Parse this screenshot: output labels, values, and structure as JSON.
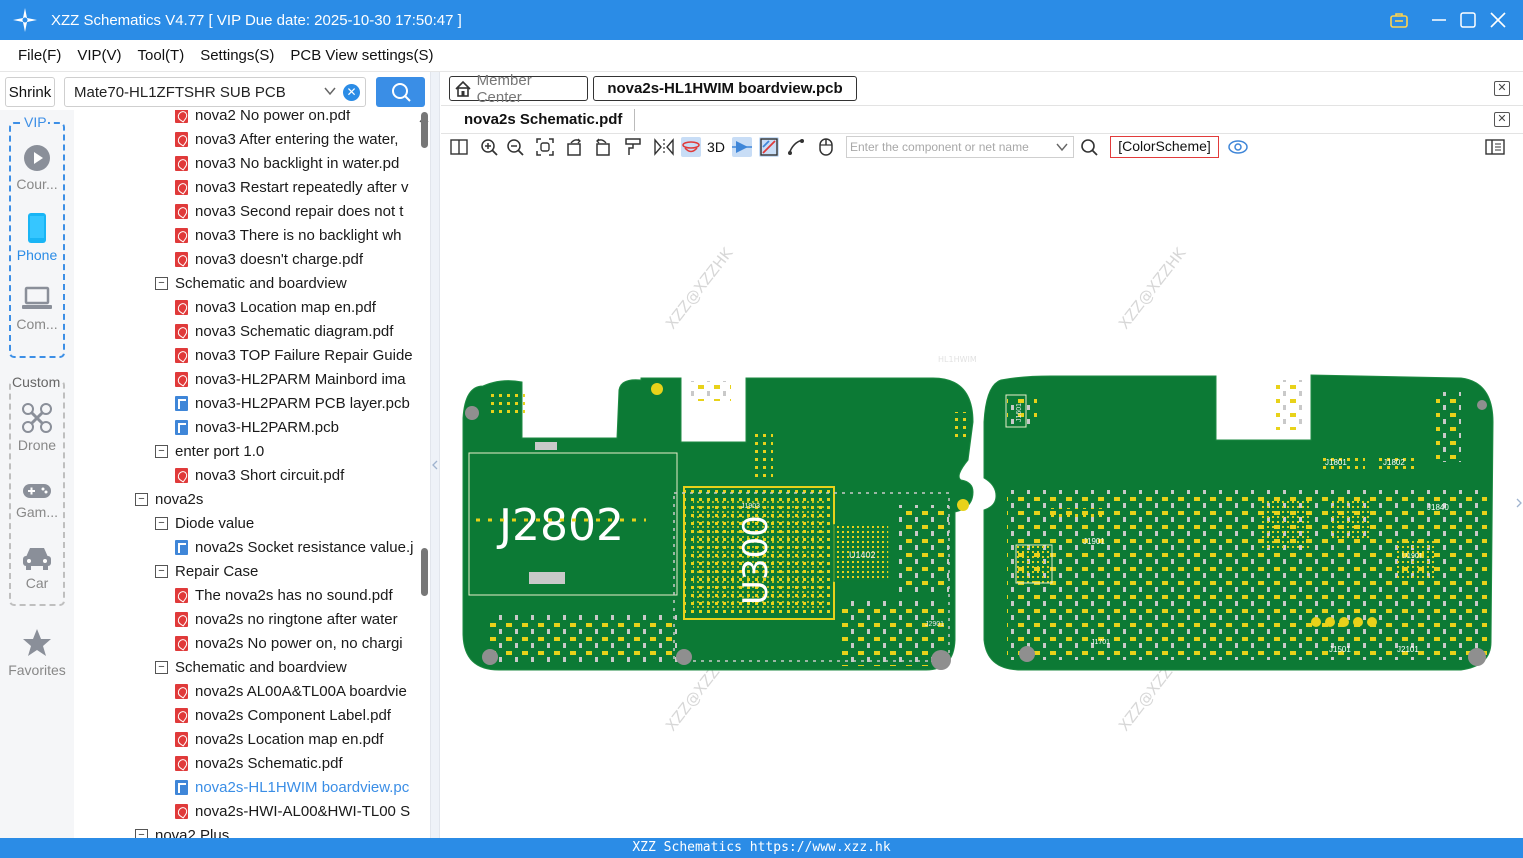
{
  "window": {
    "title": "XZZ Schematics V4.77 [ VIP Due date: 2025-10-30 17:50:47 ]"
  },
  "menu": [
    "File(F)",
    "VIP(V)",
    "Tool(T)",
    "Settings(S)",
    "PCB View settings(S)"
  ],
  "search": {
    "shrink_label": "Shrink",
    "model_value": "Mate70-HL1ZFTSHR SUB PCB"
  },
  "rail": {
    "vip_label": "VIP",
    "custom_label": "Custom",
    "categories": [
      {
        "label": "Cour...",
        "icon": "play-course-icon"
      },
      {
        "label": "Phone",
        "icon": "phone-icon"
      },
      {
        "label": "Com...",
        "icon": "laptop-icon"
      },
      {
        "label": "Drone",
        "icon": "drone-icon"
      },
      {
        "label": "Gam...",
        "icon": "gamepad-icon"
      },
      {
        "label": "Car",
        "icon": "car-icon"
      },
      {
        "label": "Favorites",
        "icon": "star-icon"
      }
    ]
  },
  "tree": [
    {
      "label": "nova2 No power on.pdf",
      "type": "pdf",
      "level": 2
    },
    {
      "label": "nova3 After entering the water,",
      "type": "pdf",
      "level": 2
    },
    {
      "label": "nova3 No backlight in water.pd",
      "type": "pdf",
      "level": 2
    },
    {
      "label": "nova3 Restart repeatedly after v",
      "type": "pdf",
      "level": 2
    },
    {
      "label": "nova3 Second repair does not t",
      "type": "pdf",
      "level": 2
    },
    {
      "label": "nova3 There is no backlight wh",
      "type": "pdf",
      "level": 2
    },
    {
      "label": "nova3 doesn't charge.pdf",
      "type": "pdf",
      "level": 2
    },
    {
      "label": "Schematic and boardview",
      "type": "folder",
      "level": 1
    },
    {
      "label": "nova3 Location map en.pdf",
      "type": "pdf",
      "level": 2
    },
    {
      "label": "nova3 Schematic diagram.pdf",
      "type": "pdf",
      "level": 2
    },
    {
      "label": "nova3 TOP Failure Repair Guide",
      "type": "pdf",
      "level": 2
    },
    {
      "label": "nova3-HL2PARM Mainbord ima",
      "type": "pdf",
      "level": 2
    },
    {
      "label": "nova3-HL2PARM PCB layer.pcb",
      "type": "pcb",
      "level": 2
    },
    {
      "label": "nova3-HL2PARM.pcb",
      "type": "pcb",
      "level": 2
    },
    {
      "label": "enter port 1.0",
      "type": "folder",
      "level": 1
    },
    {
      "label": "nova3  Short circuit.pdf",
      "type": "pdf",
      "level": 2
    },
    {
      "label": "nova2s",
      "type": "folder",
      "level": 0
    },
    {
      "label": "Diode value",
      "type": "folder",
      "level": 1
    },
    {
      "label": "nova2s Socket resistance value.j",
      "type": "pcb",
      "level": 2
    },
    {
      "label": "Repair Case",
      "type": "folder",
      "level": 1
    },
    {
      "label": "The nova2s has no sound.pdf",
      "type": "pdf",
      "level": 2
    },
    {
      "label": "nova2s  no ringtone after water",
      "type": "pdf",
      "level": 2
    },
    {
      "label": "nova2s No power on, no chargi",
      "type": "pdf",
      "level": 2
    },
    {
      "label": "Schematic and boardview",
      "type": "folder",
      "level": 1
    },
    {
      "label": "nova2s AL00A&TL00A boardvie",
      "type": "pdf",
      "level": 2
    },
    {
      "label": "nova2s Component Label.pdf",
      "type": "pdf",
      "level": 2
    },
    {
      "label": "nova2s Location map en.pdf",
      "type": "pdf",
      "level": 2
    },
    {
      "label": "nova2s Schematic.pdf",
      "type": "pdf",
      "level": 2
    },
    {
      "label": "nova2s-HL1HWIM boardview.pc",
      "type": "pcb",
      "level": 2,
      "selected": true
    },
    {
      "label": "nova2s-HWI-AL00&HWI-TL00 S",
      "type": "pdf",
      "level": 2
    },
    {
      "label": "nova2 Plus",
      "type": "folder",
      "level": 0
    }
  ],
  "tabs": {
    "member_center": "Member Center",
    "active_tab": "nova2s-HL1HWIM boardview.pcb",
    "sub_tab": "nova2s Schematic.pdf"
  },
  "toolbar": {
    "three_d_label": "3D",
    "component_placeholder": "Enter the component or net name",
    "color_scheme_label": "[ColorScheme]"
  },
  "board": {
    "watermark": "XZZ@XZZHK",
    "board_name": "HL1HWIM",
    "labels": [
      "J2802",
      "U300",
      "U1402",
      "J1903",
      "J2901",
      "J1801",
      "J1802",
      "J1901",
      "J1701",
      "J1501",
      "J2101",
      "J1601",
      "U1901",
      "J1840"
    ],
    "pcb_green": "#0c7a35",
    "trace_yellow": "#e8d21a"
  },
  "status": {
    "text": "XZZ Schematics https://www.xzz.hk"
  }
}
